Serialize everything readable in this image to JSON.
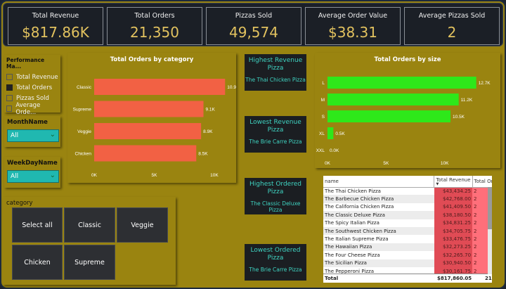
{
  "kpis": [
    {
      "label": "Total Revenue",
      "value": "$817.86K"
    },
    {
      "label": "Total Orders",
      "value": "21,350"
    },
    {
      "label": "Pizzas Sold",
      "value": "49,574"
    },
    {
      "label": "Average Order Value",
      "value": "$38.31"
    },
    {
      "label": "Average Pizzas Sold",
      "value": "2"
    }
  ],
  "measure_slicer": {
    "title": "Performance Ma...",
    "items": [
      {
        "label": "Total Revenue",
        "checked": false
      },
      {
        "label": "Total Orders",
        "checked": true
      },
      {
        "label": "Pizzas Sold",
        "checked": false
      },
      {
        "label": "Average Orde...",
        "checked": false
      }
    ]
  },
  "month_slicer": {
    "title": "MonthName",
    "value": "All"
  },
  "weekday_slicer": {
    "title": "WeekDayName",
    "value": "All"
  },
  "category_slicer": {
    "title": "category",
    "buttons": [
      "Select all",
      "Classic",
      "Veggie",
      "Chicken",
      "Supreme"
    ]
  },
  "cards": {
    "highest_revenue": {
      "title": "Highest Revenue Pizza",
      "value": "The Thai Chicken Pizza"
    },
    "lowest_revenue": {
      "title": "Lowest Revenue Pizza",
      "value": "The Brie Carre Pizza"
    },
    "highest_ordered": {
      "title": "Highest Ordered Pizza",
      "value": "The Classic Deluxe Pizza"
    },
    "lowest_ordered": {
      "title": "Lowest Ordered Pizza",
      "value": "The Brie Carre Pizza"
    }
  },
  "chart_data": [
    {
      "type": "bar",
      "title": "Total Orders by category",
      "categories": [
        "Classic",
        "Supreme",
        "Veggie",
        "Chicken"
      ],
      "values": [
        10.9,
        9.1,
        8.9,
        8.5
      ],
      "labels": [
        "10.9K",
        "9.1K",
        "8.9K",
        "8.5K"
      ],
      "ticks": [
        "0K",
        "5K",
        "10K"
      ],
      "xlim": [
        0,
        11
      ],
      "color": "#f26144"
    },
    {
      "type": "bar",
      "title": "Total Orders by size",
      "categories": [
        "L",
        "M",
        "S",
        "XL",
        "XXL"
      ],
      "values": [
        12.7,
        11.2,
        10.5,
        0.5,
        0.0
      ],
      "labels": [
        "12.7K",
        "11.2K",
        "10.5K",
        "0.5K",
        "0.0K"
      ],
      "ticks": [
        "0K",
        "5K",
        "10K"
      ],
      "xlim": [
        0,
        13.5
      ],
      "color": "#2ee81a"
    }
  ],
  "table": {
    "headers": [
      "name",
      "Total Revenue",
      "Total Or"
    ],
    "rows": [
      {
        "name": "The Thai Chicken Pizza",
        "rev": "$43,434.25",
        "ord": "2"
      },
      {
        "name": "The Barbecue Chicken Pizza",
        "rev": "$42,768.00",
        "ord": "2"
      },
      {
        "name": "The California Chicken Pizza",
        "rev": "$41,409.50",
        "ord": "2"
      },
      {
        "name": "The Classic Deluxe Pizza",
        "rev": "$38,180.50",
        "ord": "2"
      },
      {
        "name": "The Spicy Italian Pizza",
        "rev": "$34,831.25",
        "ord": "2"
      },
      {
        "name": "The Southwest Chicken Pizza",
        "rev": "$34,705.75",
        "ord": "2"
      },
      {
        "name": "The Italian Supreme Pizza",
        "rev": "$33,476.75",
        "ord": "2"
      },
      {
        "name": "The Hawaiian Pizza",
        "rev": "$32,273.25",
        "ord": "2"
      },
      {
        "name": "The Four Cheese Pizza",
        "rev": "$32,265.70",
        "ord": "2"
      },
      {
        "name": "The Sicilian Pizza",
        "rev": "$30,940.50",
        "ord": "2"
      },
      {
        "name": "The Pepperoni Pizza",
        "rev": "$30,161.75",
        "ord": "2"
      }
    ],
    "total": {
      "label": "Total",
      "rev": "$817,860.05",
      "ord": "21,"
    }
  }
}
